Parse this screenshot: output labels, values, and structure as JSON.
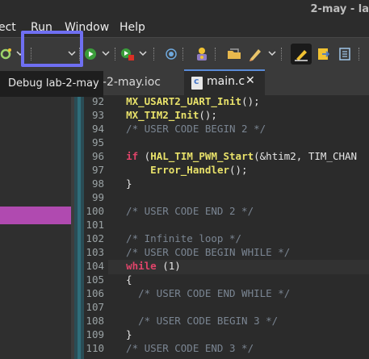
{
  "window": {
    "title": "2-may - la"
  },
  "menu": [
    "ect",
    "Run",
    "Window",
    "Help"
  ],
  "tooltip": "Debug lab-2-may",
  "tabs": {
    "ioc_label": "b-2-may.ioc",
    "active_label": "main.c",
    "close_glyph": "✕"
  },
  "editor": {
    "lines": [
      {
        "n": "92",
        "t": "  MX_USART2_UART_Init();",
        "kind": "func"
      },
      {
        "n": "93",
        "t": "  MX_TIM2_Init();",
        "kind": "func"
      },
      {
        "n": "94",
        "t": "  /* USER CODE BEGIN 2 */",
        "kind": "comment"
      },
      {
        "n": "95",
        "t": "",
        "kind": "plain"
      },
      {
        "n": "96",
        "t": "  if (HAL_TIM_PWM_Start(&htim2, TIM_CHAN",
        "kind": "if"
      },
      {
        "n": "97",
        "t": "      Error_Handler();",
        "kind": "func"
      },
      {
        "n": "98",
        "t": "  }",
        "kind": "plain"
      },
      {
        "n": "99",
        "t": "",
        "kind": "plain"
      },
      {
        "n": "100",
        "t": "  /* USER CODE END 2 */",
        "kind": "comment"
      },
      {
        "n": "101",
        "t": "",
        "kind": "plain"
      },
      {
        "n": "102",
        "t": "  /* Infinite loop */",
        "kind": "comment"
      },
      {
        "n": "103",
        "t": "  /* USER CODE BEGIN WHILE */",
        "kind": "comment"
      },
      {
        "n": "104",
        "t": "  while (1)",
        "kind": "while"
      },
      {
        "n": "105",
        "t": "  {",
        "kind": "plain"
      },
      {
        "n": "106",
        "t": "    /* USER CODE END WHILE */",
        "kind": "comment"
      },
      {
        "n": "107",
        "t": "",
        "kind": "plain"
      },
      {
        "n": "108",
        "t": "    /* USER CODE BEGIN 3 */",
        "kind": "comment"
      },
      {
        "n": "109",
        "t": "  }",
        "kind": "plain"
      },
      {
        "n": "110",
        "t": "  /* USER CODE END 3 */",
        "kind": "comment"
      }
    ],
    "current_line": "104"
  },
  "colors": {
    "highlight": "#6f6ff2",
    "selection": "#b04ab0",
    "keyword": "#e0446a",
    "function": "#e8e16a",
    "comment": "#7a8592"
  },
  "icons": [
    "build-icon",
    "debug-icon",
    "run-icon",
    "stop-run-icon",
    "target-icon",
    "device-config-icon",
    "open-folder-icon",
    "edit-icon",
    "mark-occurrences-icon",
    "next-annotation-icon",
    "view-icon"
  ]
}
